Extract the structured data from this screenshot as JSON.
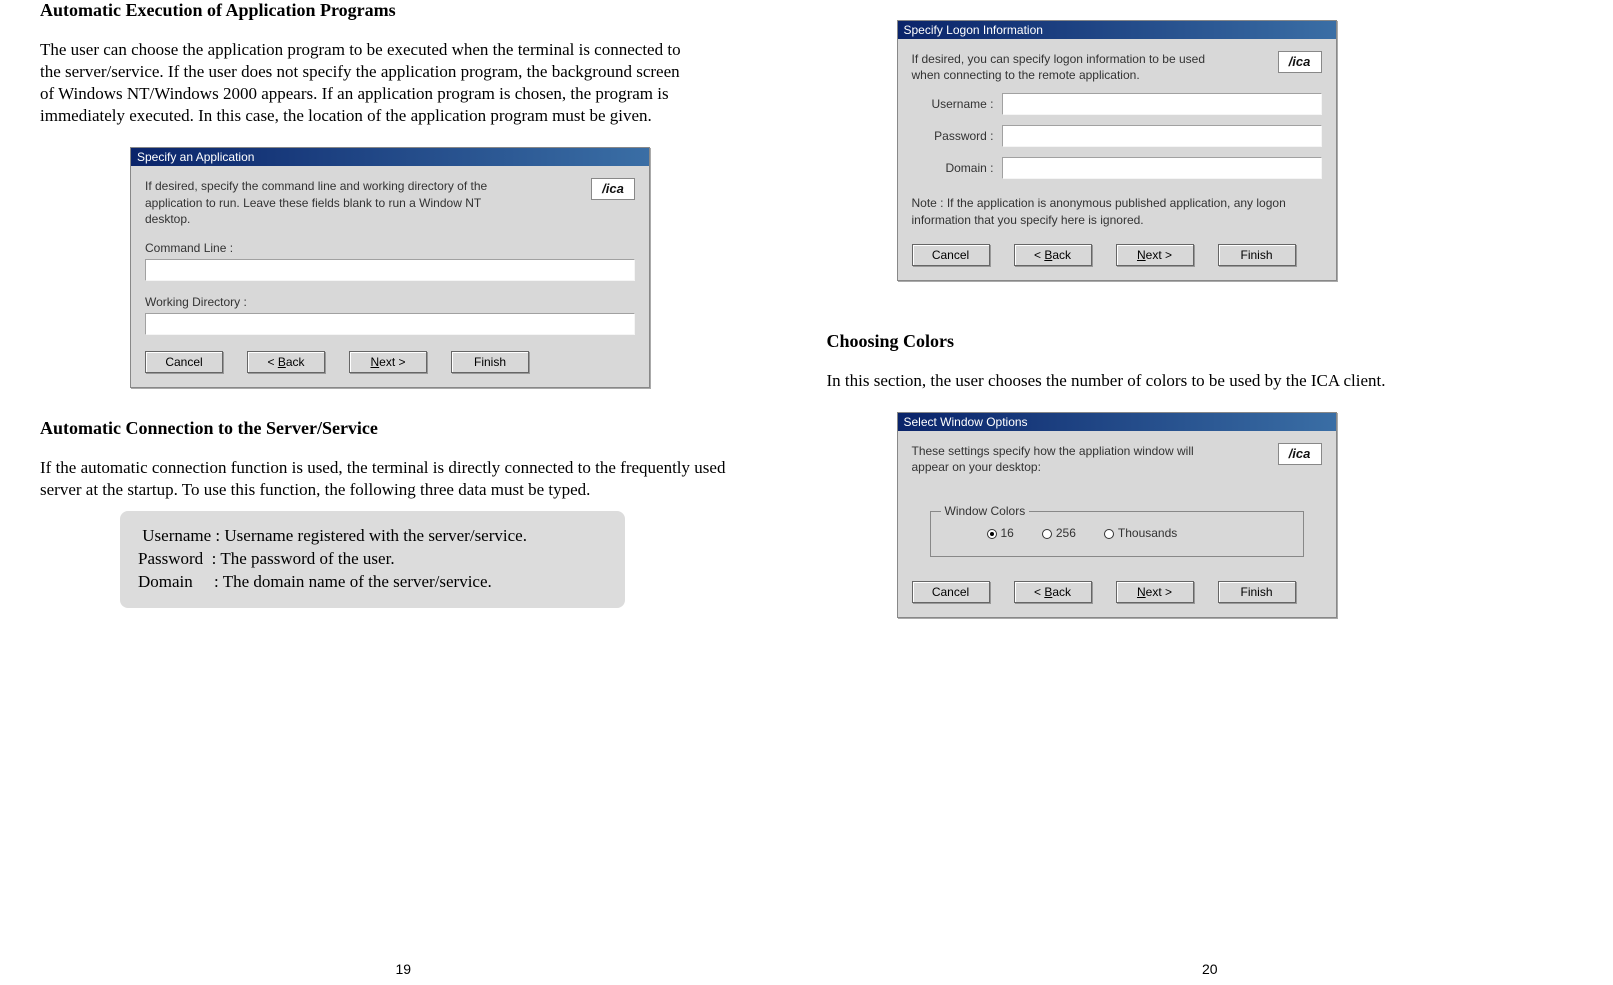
{
  "left": {
    "h1": "Automatic Execution of Application Programs",
    "p1": "The user can choose the application program to be executed when the terminal is connected to the server/service. If the user does not specify the application program, the background screen of Windows NT/Windows 2000 appears. If an application program is chosen, the program is immediately executed. In this case, the location of the application program must be given.",
    "dlg1": {
      "title": "Specify an Application",
      "desc": "If desired, specify the command line and working directory of the application to run. Leave these fields blank to run a Window NT desktop.",
      "cmd_label": "Command Line :",
      "wd_label": "Working Directory :",
      "buttons": {
        "cancel": "Cancel",
        "back": "< Back",
        "next": "Next >",
        "finish": "Finish"
      }
    },
    "h2": "Automatic Connection to the Server/Service",
    "p2": "If the automatic connection function is used, the terminal is directly connected to the frequently used server at the startup. To use this function, the following three data must be typed.",
    "info": {
      "u_label": "Username :",
      "u_text": "Username registered with the server/service.",
      "p_label": "Password  :",
      "p_text": "The password of the user.",
      "d_label": "Domain     :",
      "d_text": "The domain name of the server/service."
    },
    "pagenum": "19"
  },
  "right": {
    "dlg2": {
      "title": "Specify Logon Information",
      "desc": "If desired, you can specify logon information to be used when connecting to the remote application.",
      "u_label": "Username :",
      "p_label": "Password :",
      "d_label": "Domain :",
      "note": "Note : If the application is anonymous published application, any logon information that you specify here is ignored.",
      "buttons": {
        "cancel": "Cancel",
        "back": "< Back",
        "next": "Next >",
        "finish": "Finish"
      }
    },
    "h3": "Choosing Colors",
    "p3": "In this section, the user chooses the number of colors to be used by the ICA client.",
    "dlg3": {
      "title": "Select Window Options",
      "desc": "These settings specify how the appliation window will appear on your desktop:",
      "legend": "Window Colors",
      "opt16": "16",
      "opt256": "256",
      "optThousands": "Thousands",
      "buttons": {
        "cancel": "Cancel",
        "back": "< Back",
        "next": "Next >",
        "finish": "Finish"
      }
    },
    "pagenum": "20"
  }
}
